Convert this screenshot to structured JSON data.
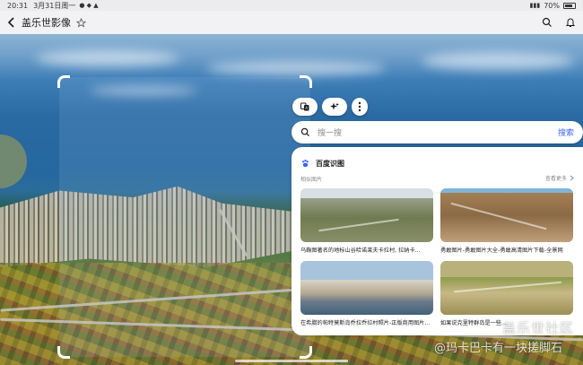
{
  "status_bar": {
    "time": "20:31",
    "date": "3月31日周一",
    "battery": "70%"
  },
  "title_bar": {
    "title": "盖乐世影像"
  },
  "actions": {
    "translate_icon": "translate-icon",
    "magic_icon": "sparkle-icon",
    "more_icon": "more-vertical-icon"
  },
  "search": {
    "placeholder": "搜一搜",
    "button": "搜索"
  },
  "panel": {
    "source_name": "百度识图",
    "section_label": "相似图片",
    "more_label": "查看更多",
    "results": [
      {
        "caption": "乌鞠图著名的地标山谷哈诺莱夫卡拉村, 拉纳卡..."
      },
      {
        "caption": "勇敢图片-勇敢图片大全-勇敢高清图片下载-全景网"
      },
      {
        "caption": "在希腊的帕特莫斯岛乔拉乔拉村照片-正版商用图片..."
      },
      {
        "caption": "如果说克里特群岛是一些..."
      }
    ]
  },
  "watermark": {
    "line1": "盖乐世社区",
    "line2": "@玛卡巴卡有一块搓脚石"
  },
  "colors": {
    "accent": "#3d64ff",
    "panel_bg": "#ffffff"
  }
}
